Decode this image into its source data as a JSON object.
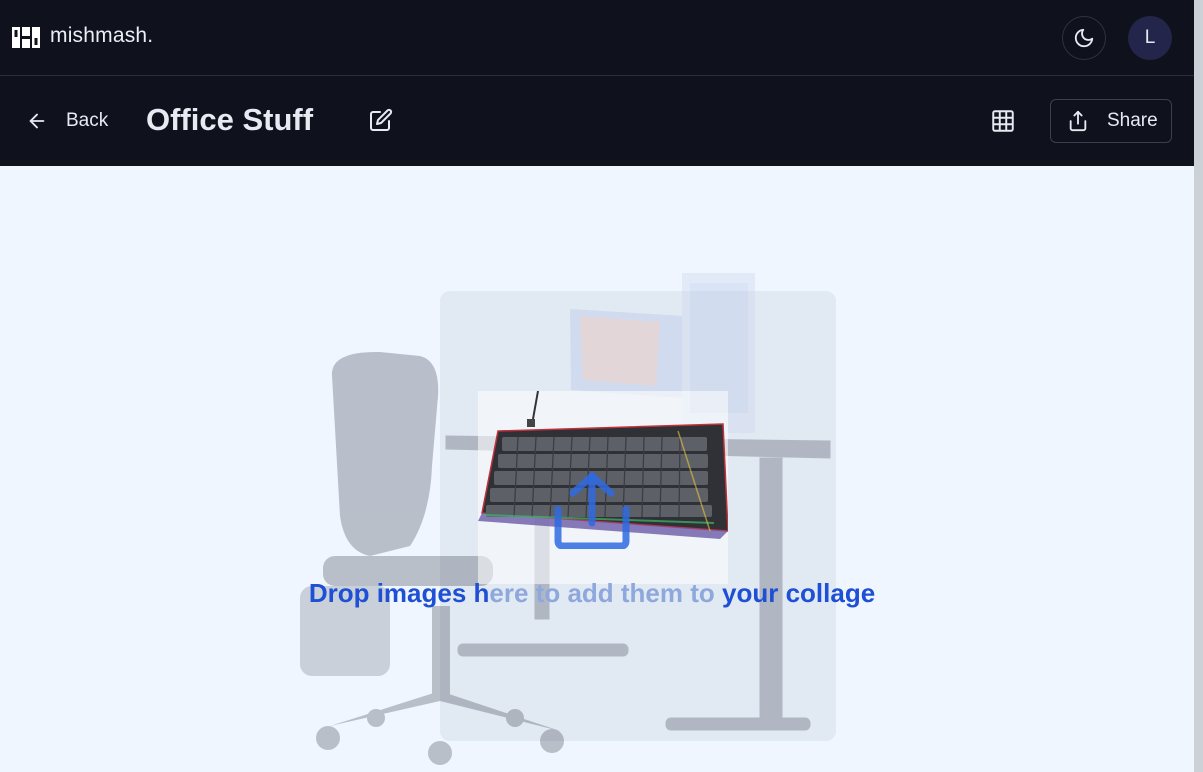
{
  "app": {
    "brand_name": "mishmash.",
    "avatar_initial": "L"
  },
  "toolbar": {
    "back_label": "Back",
    "collage_title": "Office Stuff",
    "share_label": "Share"
  },
  "dropzone": {
    "message_start": "Drop images h",
    "message_middle": "ere to add them to",
    "message_end": " your collage"
  },
  "icons": {
    "logo": "mishmash-logo-icon",
    "theme": "moon-icon",
    "back": "arrow-left-icon",
    "edit": "edit-square-icon",
    "layout": "grid-icon",
    "share": "share-upload-icon",
    "upload": "upload-icon"
  },
  "colors": {
    "header_bg": "#0f111c",
    "canvas_bg": "#eff6ff",
    "accent": "#1e4fd4"
  }
}
